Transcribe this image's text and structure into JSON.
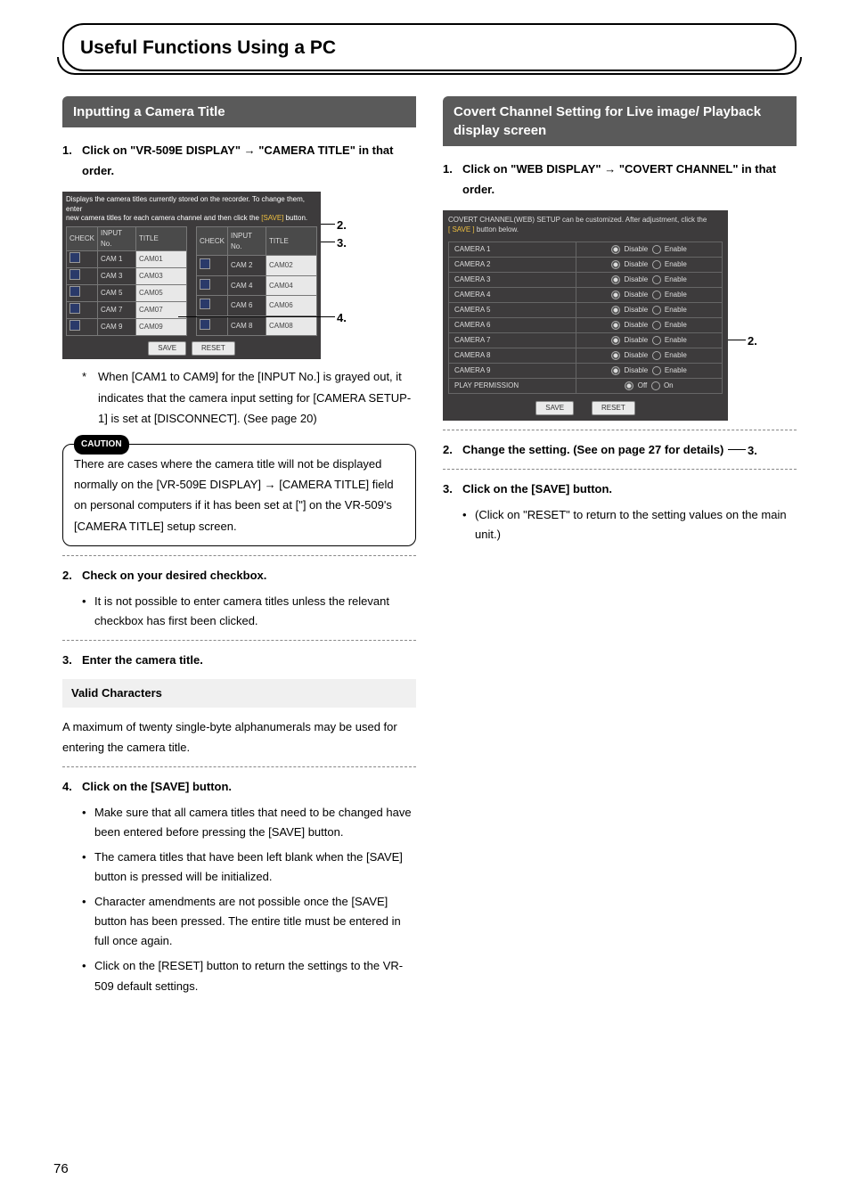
{
  "page_number": "76",
  "chapter_title": "Useful Functions Using a PC",
  "left": {
    "section_title": "Inputting a Camera Title",
    "step1": {
      "num": "1.",
      "text_a": "Click on \"VR-509E DISPLAY\" ",
      "arrow": "→",
      "text_b": " \"CAMERA TITLE\" in that order."
    },
    "shot": {
      "head_l1": "Displays the camera titles currently stored on the recorder. To change them, enter",
      "head_l2_a": "new camera titles for each camera channel and then click the ",
      "head_l2_save": "[SAVE]",
      "head_l2_b": " button.",
      "th_check": "CHECK",
      "th_input": "INPUT No.",
      "th_title": "TITLE",
      "rows_left": [
        {
          "cam": "CAM 1",
          "title": "CAM01"
        },
        {
          "cam": "CAM 3",
          "title": "CAM03"
        },
        {
          "cam": "CAM 5",
          "title": "CAM05"
        },
        {
          "cam": "CAM 7",
          "title": "CAM07"
        },
        {
          "cam": "CAM 9",
          "title": "CAM09"
        }
      ],
      "rows_right": [
        {
          "cam": "CAM 2",
          "title": "CAM02"
        },
        {
          "cam": "CAM 4",
          "title": "CAM04"
        },
        {
          "cam": "CAM 6",
          "title": "CAM06"
        },
        {
          "cam": "CAM 8",
          "title": "CAM08"
        }
      ],
      "save": "SAVE",
      "reset": "RESET"
    },
    "callout2": "2.",
    "callout3": "3.",
    "callout4": "4.",
    "note": {
      "mark": "*",
      "text": "When [CAM1 to CAM9] for the [INPUT No.] is grayed out, it indicates that the camera input setting for [CAMERA SETUP-1] is set at [DISCONNECT]. (See page 20)"
    },
    "caution_tag": "CAUTION",
    "caution_text": "There are cases where the camera title will not be displayed normally on the [VR-509E DISPLAY] → [CAMERA TITLE] field on personal computers if it has been set at [\"] on the VR-509's [CAMERA TITLE] setup screen.",
    "step2": {
      "num": "2.",
      "text": "Check on your desired checkbox."
    },
    "step2_bullet": "It is not possible to enter camera titles unless the relevant checkbox has first been clicked.",
    "step3": {
      "num": "3.",
      "text": "Enter the camera title."
    },
    "valid_heading": "Valid Characters",
    "valid_para": "A maximum of twenty single-byte alphanumerals may be used for entering the camera title.",
    "step4": {
      "num": "4.",
      "text": "Click on the [SAVE] button."
    },
    "step4_bullets": [
      "Make sure that all camera titles that need to be changed have been entered before pressing the [SAVE] button.",
      "The camera titles that have been left blank when the [SAVE] button is pressed will be initialized.",
      "Character amendments are not possible once the [SAVE] button has been pressed. The entire title must be entered in full once again.",
      "Click on the [RESET] button to return the settings to the VR-509 default settings."
    ]
  },
  "right": {
    "section_title": "Covert Channel Setting for Live image/ Playback display screen",
    "step1": {
      "num": "1.",
      "text_a": "Click on \"WEB DISPLAY\" ",
      "arrow": "→",
      "text_b": " \"COVERT CHANNEL\" in that order."
    },
    "shot": {
      "head_l1": "COVERT CHANNEL(WEB) SETUP can be customized. After adjustment, click the",
      "head_l2_save": "[ SAVE ]",
      "head_l2_b": "button below.",
      "rows": [
        "CAMERA 1",
        "CAMERA 2",
        "CAMERA 3",
        "CAMERA 4",
        "CAMERA 5",
        "CAMERA 6",
        "CAMERA 7",
        "CAMERA 8",
        "CAMERA 9"
      ],
      "disable": "Disable",
      "enable": "Enable",
      "play_perm": "PLAY PERMISSION",
      "off": "Off",
      "on": "On",
      "save": "SAVE",
      "reset": "RESET"
    },
    "callout2": "2.",
    "callout3": "3.",
    "step2": {
      "num": "2.",
      "text": "Change the setting. (See on page 27 for details)"
    },
    "step3": {
      "num": "3.",
      "text": "Click on the [SAVE] button."
    },
    "step3_bullet": "(Click on \"RESET\" to return to the setting values on the main unit.)"
  }
}
